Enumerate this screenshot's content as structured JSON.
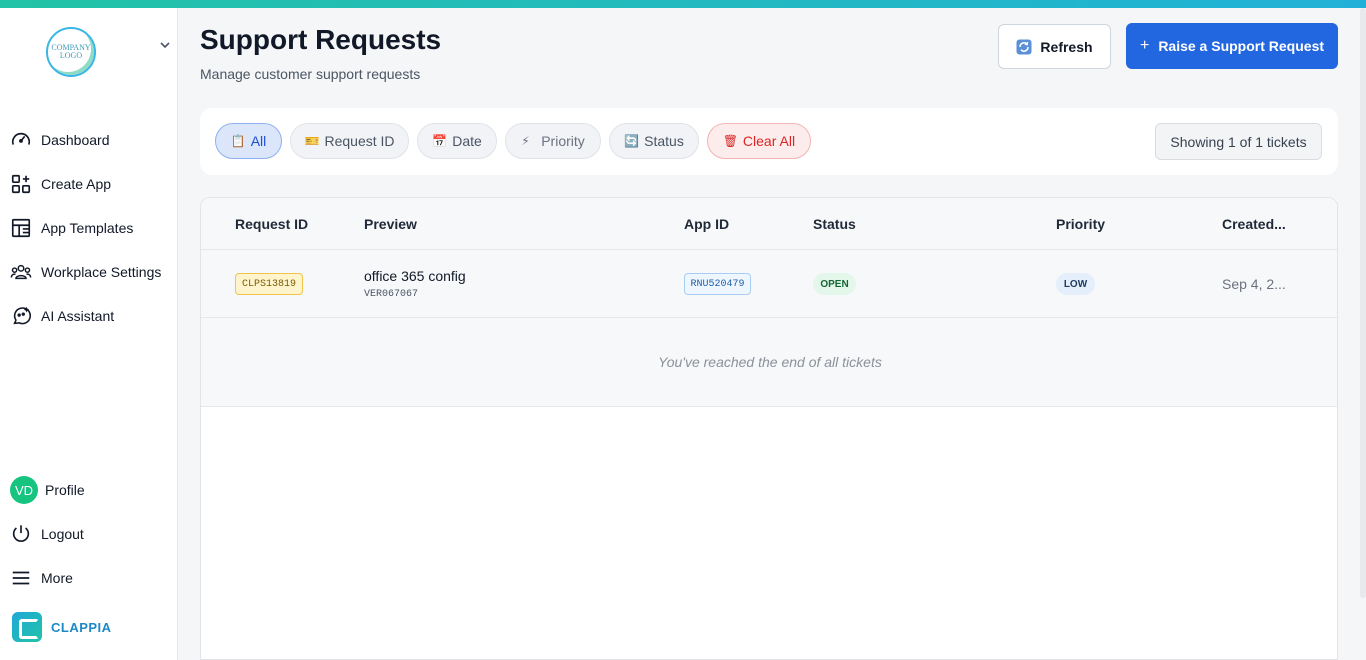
{
  "sidebar": {
    "logo_text": "COMPANY LOGO",
    "items": [
      {
        "label": "Dashboard",
        "icon": "dashboard-gauge-icon"
      },
      {
        "label": "Create App",
        "icon": "create-app-icon"
      },
      {
        "label": "App Templates",
        "icon": "templates-icon"
      },
      {
        "label": "Workplace Settings",
        "icon": "users-group-icon"
      },
      {
        "label": "AI Assistant",
        "icon": "ai-assistant-icon"
      }
    ],
    "profile": {
      "initials": "VD",
      "label": "Profile"
    },
    "logout_label": "Logout",
    "more_label": "More",
    "brand_name": "CLAPPIA"
  },
  "header": {
    "title": "Support Requests",
    "subtitle": "Manage customer support requests",
    "refresh_label": "Refresh",
    "raise_label": "Raise a Support Request",
    "raise_icon": "+"
  },
  "filters": {
    "chips": [
      {
        "label": "All",
        "icon": "📋"
      },
      {
        "label": "Request ID",
        "icon": "🎫"
      },
      {
        "label": "Date",
        "icon": "📅"
      },
      {
        "label": "Priority",
        "icon": "⚡"
      },
      {
        "label": "Status",
        "icon": "🔄"
      },
      {
        "label": "Clear All",
        "icon": "🗑"
      }
    ],
    "showing": "Showing 1 of 1 tickets"
  },
  "table": {
    "columns": [
      "Request ID",
      "Preview",
      "App ID",
      "Status",
      "Priority",
      "Created..."
    ],
    "rows": [
      {
        "request_id": "CLPS13819",
        "preview_title": "office 365 config",
        "preview_sub": "VER067067",
        "app_id": "RNU520479",
        "status": "OPEN",
        "priority": "LOW",
        "created": "Sep 4, 2..."
      }
    ],
    "end_message": "You've reached the end of all tickets"
  },
  "colors": {
    "primary": "#2367e0",
    "accent_gradient_start": "#22c3a6",
    "accent_gradient_end": "#21b1d8",
    "danger": "#dc2626"
  }
}
